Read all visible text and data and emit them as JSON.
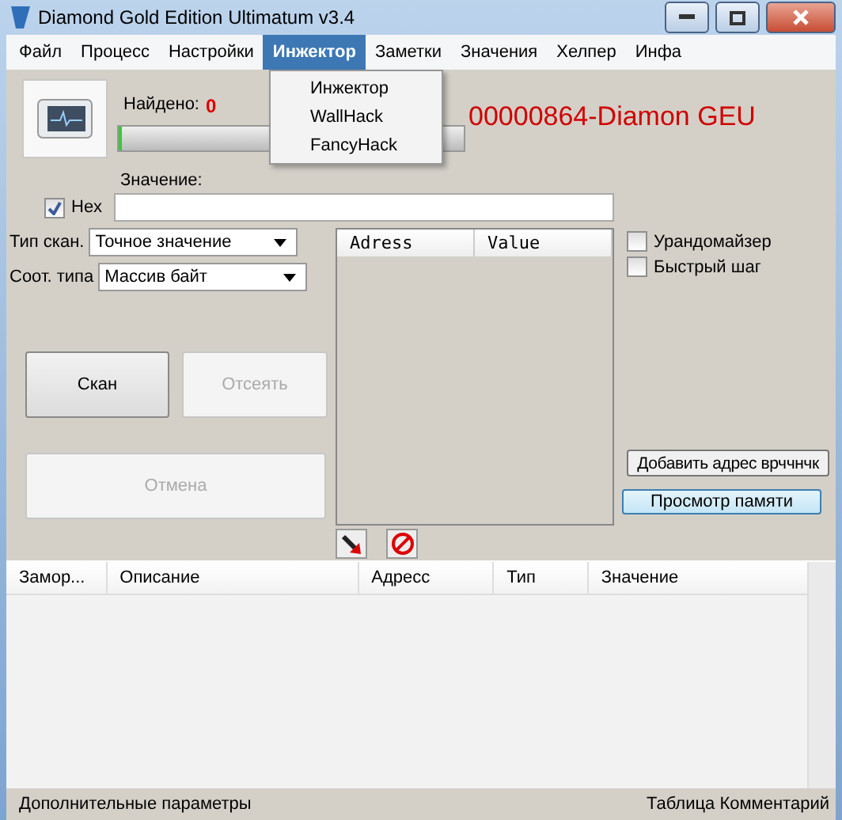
{
  "window": {
    "title": "Diamond Gold Edition Ultimatum v3.4"
  },
  "menu": [
    {
      "label": "Файл",
      "selected": false
    },
    {
      "label": "Процесс",
      "selected": false
    },
    {
      "label": "Настройки",
      "selected": false
    },
    {
      "label": "Инжектор",
      "selected": true
    },
    {
      "label": "Заметки",
      "selected": false
    },
    {
      "label": "Значения",
      "selected": false
    },
    {
      "label": "Хелпер",
      "selected": false
    },
    {
      "label": "Инфа",
      "selected": false
    }
  ],
  "dropdown": [
    "Инжектор",
    "WallHack",
    "FancyHack"
  ],
  "found": {
    "label": "Найдено:",
    "count": "0"
  },
  "progress": {
    "level": 0.01
  },
  "process_title": "00000864-Diamon GEU",
  "value_label": "Значение:",
  "hex": {
    "label": "Hex",
    "checked": true
  },
  "scan_type": {
    "label": "Тип скан.",
    "value": "Точное значение"
  },
  "value_type": {
    "label": "Соот. типа",
    "value": "Массив байт"
  },
  "buttons": [
    {
      "label": "Скан",
      "disabled": false
    },
    {
      "label": "Отсеять",
      "disabled": true
    }
  ],
  "cancel": {
    "label": "Отмена",
    "disabled": true
  },
  "results": {
    "columns": [
      "Adress",
      "Value"
    ]
  },
  "options": [
    {
      "label": "Урандомайзер",
      "checked": false
    },
    {
      "label": "Быстрый шаг",
      "checked": false
    }
  ],
  "add_address": "Добавить адрес врччнчк",
  "memory_view": "Просмотр памяти",
  "table": {
    "columns": [
      "Замор...",
      "Описание",
      "Адресс",
      "Тип",
      "Значение"
    ]
  },
  "status_bar": {
    "left": "Дополнительные параметры",
    "right": "Таблица Комментарий"
  }
}
